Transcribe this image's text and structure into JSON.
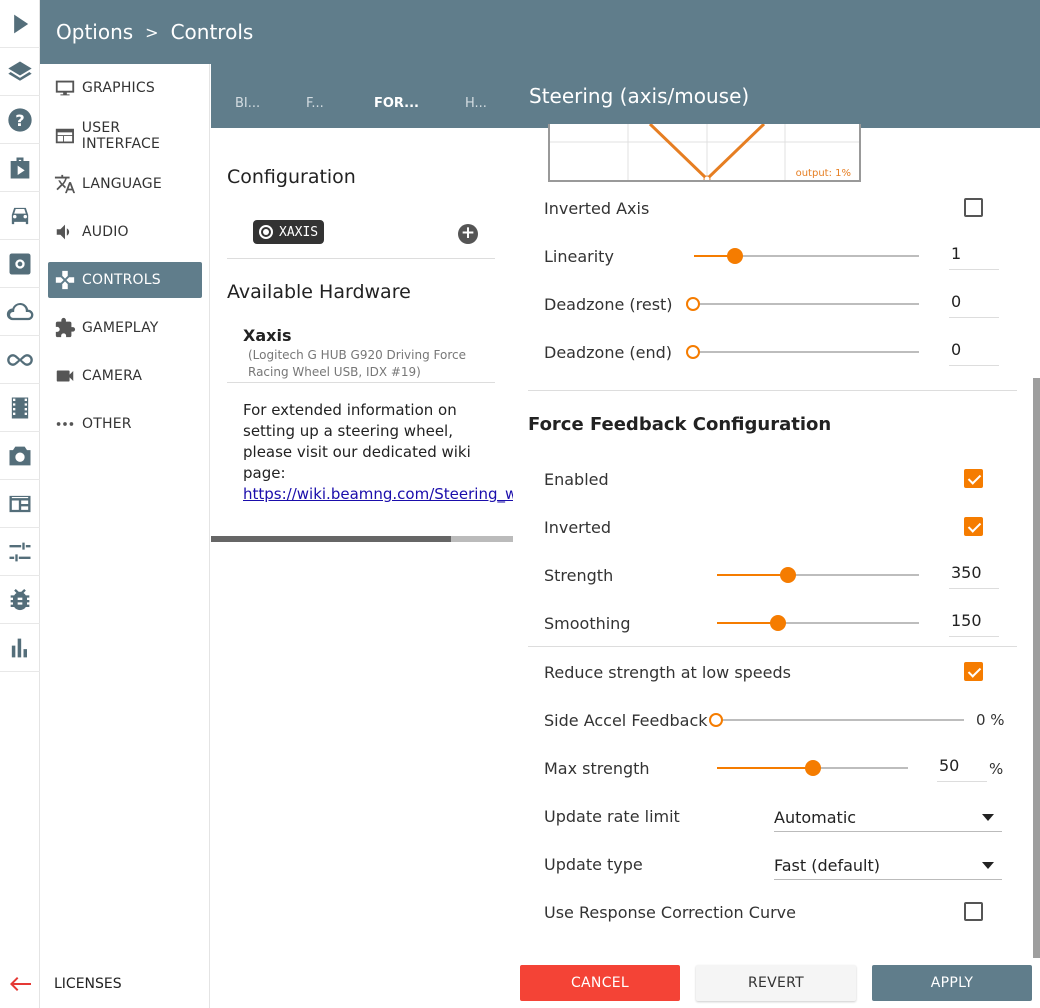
{
  "header": {
    "breadcrumb_parent": "Options",
    "breadcrumb_sep": ">",
    "breadcrumb_current": "Controls"
  },
  "rail_icons": [
    "play-icon",
    "layers-icon",
    "help-icon",
    "mission-icon",
    "car-icon",
    "settings-icon",
    "cloud-icon",
    "infinity-icon",
    "film-icon",
    "camera-icon",
    "layout-icon",
    "tune-icon",
    "bug-icon",
    "stats-icon"
  ],
  "menu": {
    "items": [
      {
        "label": "GRAPHICS",
        "icon": "monitor-icon"
      },
      {
        "label": "USER INTERFACE",
        "icon": "window-icon"
      },
      {
        "label": "LANGUAGE",
        "icon": "translate-icon"
      },
      {
        "label": "AUDIO",
        "icon": "speaker-icon"
      },
      {
        "label": "CONTROLS",
        "icon": "gamepad-icon",
        "active": true
      },
      {
        "label": "GAMEPLAY",
        "icon": "puzzle-icon"
      },
      {
        "label": "CAMERA",
        "icon": "video-camera-icon"
      },
      {
        "label": "OTHER",
        "icon": "more-icon"
      }
    ],
    "licenses": "LICENSES"
  },
  "tabs": [
    "BI...",
    "F...",
    "FOR...",
    "H..."
  ],
  "middle": {
    "config_title": "Configuration",
    "axis_chip": "XAXIS",
    "hardware_title": "Available Hardware",
    "device_name": "Xaxis",
    "device_detail": "(Logitech G HUB G920 Driving Force Racing Wheel USB, IDX #19)",
    "info_text": "For extended information on setting up a steering wheel, please visit our dedicated wiki page:",
    "info_link": "https://wiki.beamng.com/Steering_w"
  },
  "right": {
    "title": "Steering (axis/mouse)",
    "graph_output": "output: 1%",
    "inverted_axis": {
      "label": "Inverted Axis",
      "checked": false
    },
    "linearity": {
      "label": "Linearity",
      "value": "1",
      "fraction": 0.18
    },
    "deadzone_rest": {
      "label": "Deadzone (rest)",
      "value": "0",
      "fraction": 0
    },
    "deadzone_end": {
      "label": "Deadzone (end)",
      "value": "0",
      "fraction": 0
    },
    "ffb_title": "Force Feedback Configuration",
    "enabled": {
      "label": "Enabled",
      "checked": true
    },
    "inverted": {
      "label": "Inverted",
      "checked": true
    },
    "strength": {
      "label": "Strength",
      "value": "350",
      "fraction": 0.35
    },
    "smoothing": {
      "label": "Smoothing",
      "value": "150",
      "fraction": 0.3
    },
    "reduce_strength": {
      "label": "Reduce strength at low speeds",
      "checked": true
    },
    "side_accel": {
      "label": "Side Accel Feedback",
      "value": "0 %",
      "fraction": 0
    },
    "max_strength": {
      "label": "Max strength",
      "value": "50",
      "unit": "%",
      "fraction": 0.5
    },
    "update_rate": {
      "label": "Update rate limit",
      "selected": "Automatic"
    },
    "update_type": {
      "label": "Update type",
      "selected": "Fast (default)"
    },
    "response_curve": {
      "label": "Use Response Correction Curve",
      "checked": false
    }
  },
  "buttons": {
    "cancel": "CANCEL",
    "revert": "REVERT",
    "apply": "APPLY"
  },
  "colors": {
    "primary": "#607d8b",
    "accent": "#f57c00",
    "danger": "#f44336"
  }
}
